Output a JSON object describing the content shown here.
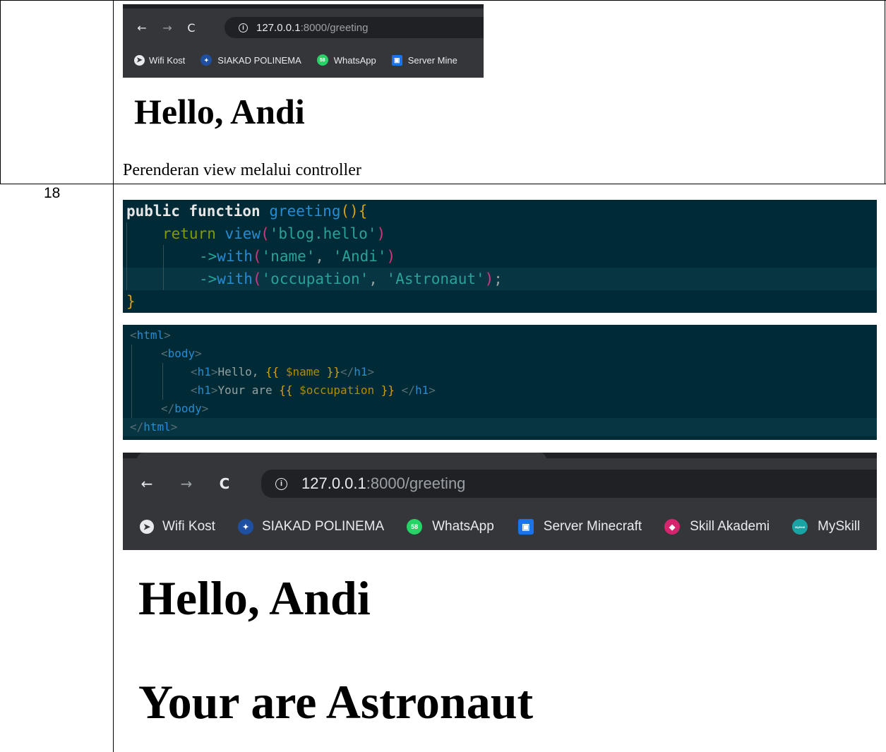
{
  "row_number": "18",
  "caption": "Perenderan view melalui controller",
  "browser_small": {
    "url_host": "127.0.0.1",
    "url_rest": ":8000/greeting",
    "bookmarks": [
      "Wifi Kost",
      "SIAKAD POLINEMA",
      "WhatsApp",
      "Server Mine"
    ],
    "heading": "Hello, Andi"
  },
  "code_controller": {
    "l1_kw": "public function",
    "l1_fn": "greeting",
    "l1_paren": "(){",
    "l2_ret": "return",
    "l2_view": "view",
    "l2_arg": "'blog.hello'",
    "l3_arrow": "->",
    "l3_with": "with",
    "l3_a1": "'name'",
    "l3_a2": "'Andi'",
    "l4_arrow": "->",
    "l4_with": "with",
    "l4_a1": "'occupation'",
    "l4_a2": "'Astronaut'",
    "l5": "}"
  },
  "code_view": {
    "html_open": "html",
    "body_open": "body",
    "h1": "h1",
    "hello_text": "Hello, ",
    "name_var": "$name",
    "your_text": "Your are ",
    "occ_var": "$occupation",
    "body_close": "body",
    "html_close": "html"
  },
  "browser_large": {
    "url_host": "127.0.0.1",
    "url_rest": ":8000/greeting",
    "bookmarks": [
      "Wifi Kost",
      "SIAKAD POLINEMA",
      "WhatsApp",
      "Server Minecraft",
      "Skill Akademi",
      "MySkill"
    ],
    "heading1": "Hello, Andi",
    "heading2": "Your are Astronaut"
  },
  "icons": {
    "whatsapp_badge": "58",
    "myskill_badge": "MySkill"
  },
  "colors": {
    "chrome_bar": "#35363a",
    "code_bg": "#002b36"
  }
}
